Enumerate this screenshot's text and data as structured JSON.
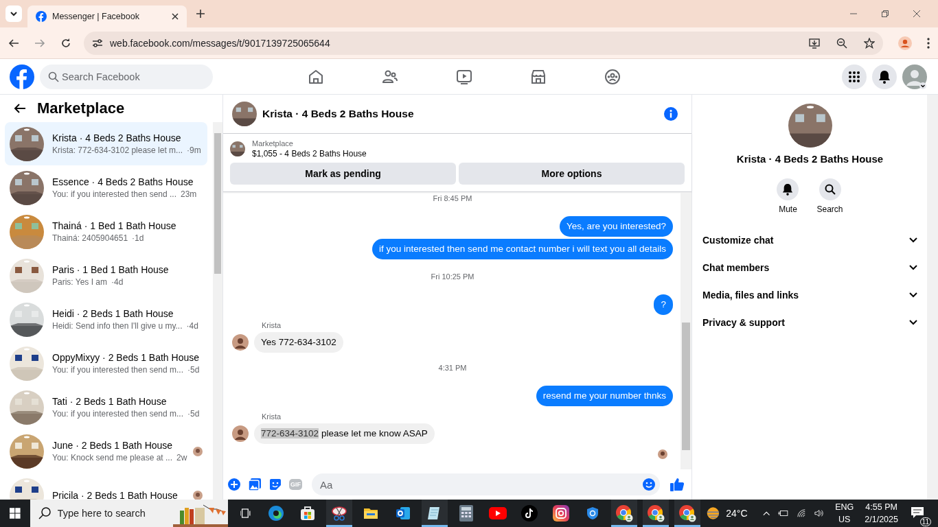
{
  "browser": {
    "tab_title": "Messenger | Facebook",
    "url": "web.facebook.com/messages/t/9017139725065644"
  },
  "header": {
    "search_placeholder": "Search Facebook"
  },
  "sidebar": {
    "title": "Marketplace",
    "conversations": [
      {
        "title": "Krista · 4 Beds 2 Baths House",
        "preview": "Krista: 772-634-3102 please let m...",
        "time": "·9m",
        "selected": true,
        "seen": false
      },
      {
        "title": "Essence · 4 Beds 2 Baths House",
        "preview": "You: if you interested then send ...",
        "time": "23m",
        "selected": false,
        "seen": false
      },
      {
        "title": "Thainá · 1 Bed 1 Bath House",
        "preview": "Thainá: 2405904651",
        "time": "·1d",
        "selected": false,
        "seen": false
      },
      {
        "title": "Paris · 1 Bed 1 Bath House",
        "preview": "Paris: Yes I am",
        "time": "·4d",
        "selected": false,
        "seen": false
      },
      {
        "title": "Heidi · 2 Beds 1 Bath House",
        "preview": "Heidi: Send info then I'll give u my...",
        "time": "·4d",
        "selected": false,
        "seen": false
      },
      {
        "title": "OppyMixyy · 2 Beds 1 Bath House",
        "preview": "You: if you interested then send m...",
        "time": "·5d",
        "selected": false,
        "seen": false
      },
      {
        "title": "Tati · 2 Beds 1 Bath House",
        "preview": "You: if you interested then send m...",
        "time": "·5d",
        "selected": false,
        "seen": false
      },
      {
        "title": "June · 2 Beds 1 Bath House",
        "preview": "You: Knock send me please at ...",
        "time": "2w",
        "selected": false,
        "seen": true
      },
      {
        "title": "Pricila · 2 Beds 1 Bath House",
        "selected": false,
        "seen": true
      }
    ]
  },
  "chat": {
    "title": "Krista · 4 Beds 2 Baths House",
    "listing": {
      "label": "Marketplace",
      "title": "$1,055 - 4 Beds 2 Baths House"
    },
    "buttons": [
      "Mark as pending",
      "More options"
    ],
    "messages": [
      {
        "kind": "time",
        "text": "Fri 8:45 PM"
      },
      {
        "kind": "out",
        "text": "Yes, are you interested?"
      },
      {
        "kind": "out",
        "text": "if you interested then send me contact number i will text you all details"
      },
      {
        "kind": "time",
        "text": "Fri 10:25 PM"
      },
      {
        "kind": "out",
        "text": "?"
      },
      {
        "kind": "in",
        "sender": "Krista",
        "text": "Yes 772-634-3102"
      },
      {
        "kind": "time",
        "text": "4:31 PM"
      },
      {
        "kind": "out",
        "text": "resend me your number thnks"
      },
      {
        "kind": "in",
        "sender": "Krista",
        "highlight": "772-634-3102",
        "text": "please let me know ASAP"
      },
      {
        "kind": "seen"
      }
    ],
    "composer": {
      "gif_label": "GIF",
      "placeholder": "Aa"
    }
  },
  "details": {
    "name": "Krista · 4 Beds 2 Baths House",
    "actions": [
      {
        "kind": "mute",
        "label": "Mute"
      },
      {
        "kind": "search",
        "label": "Search"
      }
    ],
    "sections": [
      {
        "label": "Customize chat",
        "expanded": false
      },
      {
        "label": "Chat members",
        "expanded": false
      },
      {
        "label": "Media, files and links",
        "expanded": false
      },
      {
        "label": "Privacy & support",
        "expanded": false
      }
    ]
  },
  "taskbar": {
    "search_placeholder": "Type here to search",
    "apps": [
      {
        "kind": "edge",
        "running": false
      },
      {
        "kind": "store",
        "running": false
      },
      {
        "kind": "snip",
        "running": true
      },
      {
        "kind": "folder",
        "running": false
      },
      {
        "kind": "outlook",
        "running": false
      },
      {
        "kind": "notepad",
        "running": true
      },
      {
        "kind": "calculator",
        "running": false
      },
      {
        "kind": "youtube",
        "running": false
      },
      {
        "kind": "tiktok",
        "running": false
      },
      {
        "kind": "instagram",
        "running": false
      },
      {
        "kind": "shield",
        "running": false
      },
      {
        "kind": "chrome",
        "running": true
      },
      {
        "kind": "chrome",
        "running": true
      },
      {
        "kind": "chrome",
        "running": true
      }
    ],
    "weather": "24°C",
    "lang": [
      "ENG",
      "US"
    ],
    "time": "4:55 PM",
    "date": "2/1/2025",
    "notifications": "11"
  }
}
